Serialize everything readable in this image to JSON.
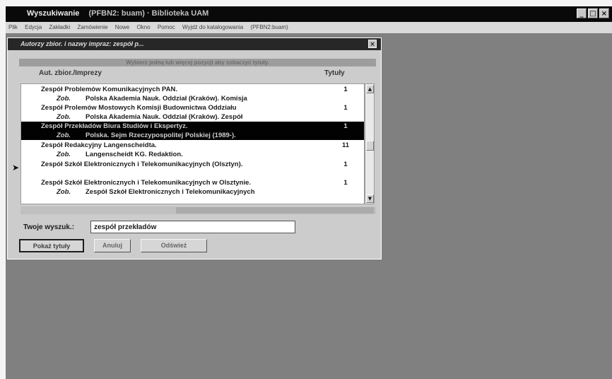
{
  "window": {
    "title": "Wyszukiwanie",
    "subtitle": "(PFBN2: buam) · Biblioteka UAM",
    "controls": [
      "_",
      "□",
      "×"
    ]
  },
  "menu": [
    "Plik",
    "Edycja",
    "Zakładki",
    "Zamówienie",
    "Nowe",
    "Okno",
    "Pomoc",
    "Wyjdź do katalogowania",
    "(PFBN2:buam)"
  ],
  "dialog": {
    "title": "Autorzy zbior. i nazwy impraz: zespół p...",
    "close": "×",
    "hint": "Wybierz jedną lub więcej pozycji aby zobaczyć tytuły.",
    "col_author": "Aut. zbior./Imprezy",
    "col_count": "Tytuły",
    "pointer": "➤",
    "rows": [
      {
        "name": "Zespół Problemów Komunikacyjnych PAN.",
        "count": "1"
      },
      {
        "zob": "Zob.",
        "name": "Polska Akademia Nauk. Oddział (Kraków). Komisja"
      },
      {
        "name": "Zespół Prolemów Mostowych Komisji Budownictwa Oddziału",
        "count": "1"
      },
      {
        "zob": "Zob.",
        "name": "Polska Akademia Nauk. Oddział (Kraków). Zespół"
      },
      {
        "name": "Zespół Przekładów Biura Studiów i Ekspertyz.",
        "count": "1"
      },
      {
        "zob": "Zob.",
        "name": "Polska. Sejm Rzeczypospolitej Polskiej (1989-)."
      },
      {
        "name": "Zespół Redakcyjny Langenscheidta.",
        "count": "11"
      },
      {
        "zob": "Zob.",
        "name": "Langenscheidt KG. Redaktion."
      },
      {
        "name": "Zespół Szkół Elektronicznych i Telekomunikacyjnych (Olsztyn).",
        "count": "1"
      },
      {
        "name": "Zespół Szkół Elektronicznych i Telekomunikacyjnych w Olsztynie.",
        "count": "1"
      },
      {
        "zob": "Zob.",
        "name": "Zespół Szkół Elektronicznych i Telekomunikacyjnych"
      }
    ],
    "scroll_up": "▲",
    "scroll_down": "▼",
    "search_label": "Twoje wyszuk.:",
    "search_value": "zespół przekładów",
    "btn_show": "Pokaż tytuły",
    "btn_cancel": "Anuluj",
    "btn_refresh": "Odśwież"
  }
}
